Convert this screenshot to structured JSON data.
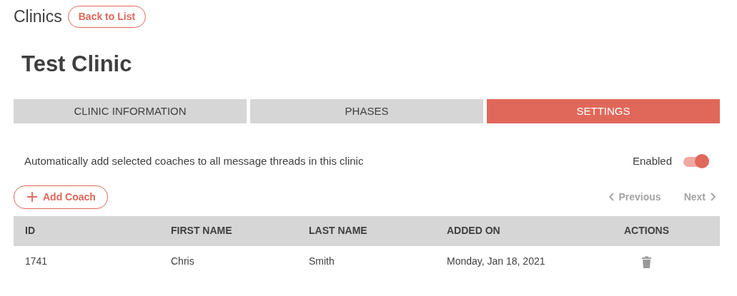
{
  "header": {
    "title": "Clinics",
    "back_button": "Back to List"
  },
  "clinic_name": "Test Clinic",
  "tabs": [
    {
      "label": "CLINIC INFORMATION",
      "selected": false
    },
    {
      "label": "PHASES",
      "selected": false
    },
    {
      "label": "SETTINGS",
      "selected": true
    }
  ],
  "setting": {
    "description": "Automatically add selected coaches to all message threads in this clinic",
    "toggle_label": "Enabled",
    "on": true
  },
  "add_button": "Add Coach",
  "pagination": [
    {
      "label": "Previous",
      "kind": "prev",
      "disabled": true
    },
    {
      "label": "Next",
      "kind": "next",
      "disabled": true
    }
  ],
  "table": {
    "columns": [
      "ID",
      "FIRST NAME",
      "LAST NAME",
      "ADDED ON",
      "ACTIONS"
    ],
    "rows": [
      {
        "cells": [
          "1741",
          "Chris",
          "Smith",
          "Monday, Jan 18, 2021"
        ]
      }
    ]
  }
}
